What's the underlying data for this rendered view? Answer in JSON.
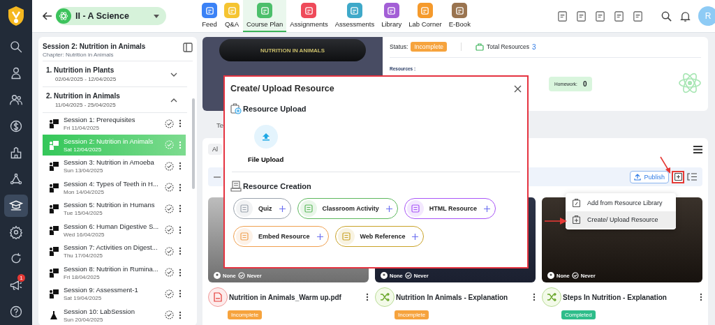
{
  "nav_rail": {
    "items": [
      {
        "kind": "search",
        "selected": false
      },
      {
        "kind": "person",
        "selected": false
      },
      {
        "kind": "people",
        "selected": false
      },
      {
        "kind": "dollar",
        "selected": false
      },
      {
        "kind": "building",
        "selected": false
      },
      {
        "kind": "network",
        "selected": false
      },
      {
        "kind": "graduation",
        "selected": true
      },
      {
        "kind": "gear",
        "selected": false
      },
      {
        "kind": "refresh",
        "selected": false
      },
      {
        "kind": "megaphone",
        "selected": false,
        "badge": "1"
      },
      {
        "kind": "help",
        "selected": false
      }
    ]
  },
  "top_bar": {
    "class_selector": {
      "value": "II - A Science"
    },
    "tabs": [
      {
        "label": "Feed",
        "color": "#3b82f6",
        "selected": false
      },
      {
        "label": "Q&A",
        "color": "#f5c431",
        "selected": false
      },
      {
        "label": "Course Plan",
        "color": "#4cbf6b",
        "selected": true
      },
      {
        "label": "Assignments",
        "color": "#ef4a5a",
        "selected": false
      },
      {
        "label": "Assessments",
        "color": "#3fa9c9",
        "selected": false
      },
      {
        "label": "Library",
        "color": "#a35fd6",
        "selected": false
      },
      {
        "label": "Lab Corner",
        "color": "#f59a2c",
        "selected": false
      },
      {
        "label": "E-Book",
        "color": "#9a7450",
        "selected": false
      }
    ],
    "avatar": "R"
  },
  "outline": {
    "title": "Session 2: Nutrition in Animals",
    "subtitle": "Chapter: Nutrition in Animals",
    "chapters": [
      {
        "title": "1. Nutrition in Plants",
        "dates": "02/04/2025 - 12/04/2025",
        "expanded": false
      },
      {
        "title": "2. Nutrition in Animals",
        "dates": "11/04/2025 - 25/04/2025",
        "expanded": true,
        "children": [
          {
            "kind": "lecture",
            "title": "Session 1: Prerequisites",
            "date": "Fri 11/04/2025",
            "selected": false
          },
          {
            "kind": "lecture",
            "title": "Session 2: Nutrition in Animals",
            "date": "Sat 12/04/2025",
            "selected": true
          },
          {
            "kind": "lecture",
            "title": "Session 3: Nutrition in Amoeba",
            "date": "Sun 13/04/2025",
            "selected": false
          },
          {
            "kind": "lecture",
            "title": "Session 4: Types of Teeth in H...",
            "date": "Mon 14/04/2025",
            "selected": false
          },
          {
            "kind": "lecture",
            "title": "Session 5: Nutrition in Humans",
            "date": "Tue 15/04/2025",
            "selected": false
          },
          {
            "kind": "lecture",
            "title": "Session 6: Human Digestive S...",
            "date": "Wed 16/04/2025",
            "selected": false
          },
          {
            "kind": "lecture",
            "title": "Session 7: Activities on Digest...",
            "date": "Thu 17/04/2025",
            "selected": false
          },
          {
            "kind": "lecture",
            "title": "Session 8: Nutrition in Rumina...",
            "date": "Fri 18/04/2025",
            "selected": false
          },
          {
            "kind": "lecture",
            "title": "Session 9: Assessment-1",
            "date": "Sat 19/04/2025",
            "selected": false
          },
          {
            "kind": "lab",
            "title": "Session 10: LabSession",
            "date": "Sun 20/04/2025",
            "selected": false
          }
        ]
      }
    ]
  },
  "summary": {
    "thumbnail_title": "NUTRITION IN ANIMALS",
    "status_label": "Status:",
    "status": "Incomplete",
    "total_label": "Total Resources",
    "total": "3",
    "resources_label": "Resources :",
    "homework_label": "Homework:",
    "homework": "0"
  },
  "section_tab": "Te",
  "filter_chip": "Al",
  "toolbar": {
    "publish": "Publish"
  },
  "resources": [
    {
      "kind": "pdf",
      "title": "Nutrition in Animals_Warm up.pdf",
      "assignee": "None",
      "due": "Never",
      "status": "Incomplete",
      "completed": false
    },
    {
      "kind": "video",
      "title": "Nutrition In Animals - Explanation",
      "assignee": "None",
      "due": "Never",
      "status": "Incomplete",
      "completed": false
    },
    {
      "kind": "video",
      "title": "Steps In Nutrition - Explanation",
      "assignee": "None",
      "due": "Never",
      "status": "Completed",
      "completed": true
    }
  ],
  "menu": {
    "items": [
      {
        "label": "Add from Resource Library",
        "selected": false
      },
      {
        "label": "Create/ Upload Resource",
        "selected": true
      }
    ]
  },
  "modal": {
    "title": "Create/ Upload Resource",
    "upload_heading": "Resource Upload",
    "upload_action": "File Upload",
    "creation_heading": "Resource Creation",
    "creation_items": [
      {
        "label": "Quiz",
        "color": "#9aa3ad"
      },
      {
        "label": "Classroom Activity",
        "color": "#5cb85c"
      },
      {
        "label": "HTML Resource",
        "color": "#a855f7"
      },
      {
        "label": "Embed Resource",
        "color": "#f0a050"
      },
      {
        "label": "Web Reference",
        "color": "#c9a227"
      }
    ]
  }
}
